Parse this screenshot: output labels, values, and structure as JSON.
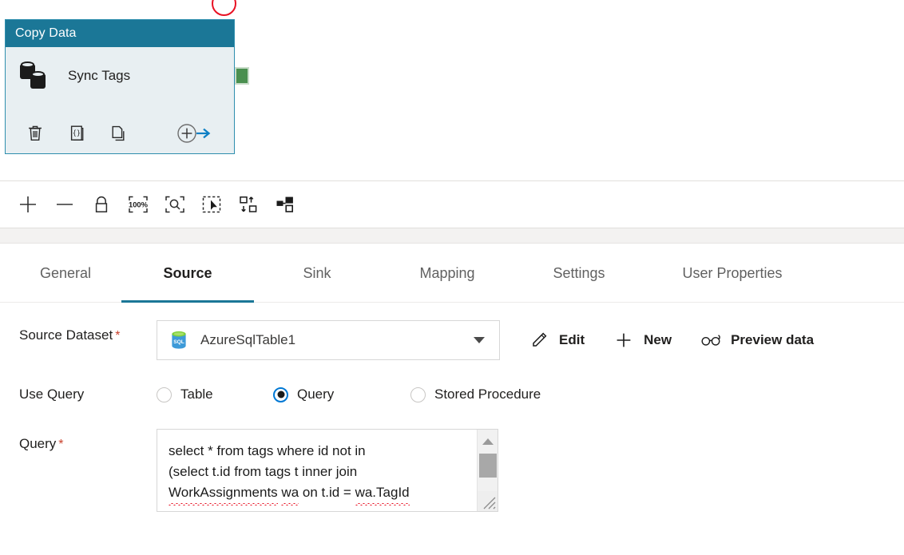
{
  "canvas": {
    "validation_marker": "error-circle",
    "activity": {
      "type_label": "Copy Data",
      "name": "Sync Tags",
      "icon": "copy-data-databases-icon",
      "actions": [
        {
          "name": "delete",
          "icon": "trash-icon"
        },
        {
          "name": "code",
          "icon": "code-braces-icon"
        },
        {
          "name": "clone",
          "icon": "copy-pages-icon"
        },
        {
          "name": "add-output",
          "icon": "add-output-arrow-icon"
        }
      ],
      "output_connector": "success-output",
      "header_color": "#1b7797",
      "body_color": "#e8eff2",
      "connector_color": "#4a8f4f",
      "validation_color": "#e81123"
    }
  },
  "canvas_toolbar": {
    "buttons": [
      {
        "name": "zoom-in",
        "icon": "plus-icon",
        "title": "Zoom in"
      },
      {
        "name": "zoom-out",
        "icon": "minus-icon",
        "title": "Zoom out"
      },
      {
        "name": "lock-canvas",
        "icon": "lock-icon",
        "title": "Lock canvas"
      },
      {
        "name": "zoom-to-100",
        "icon": "hundred-percent-icon",
        "title": "Zoom to 100%"
      },
      {
        "name": "zoom-to-fit",
        "icon": "zoom-fit-icon",
        "title": "Zoom to fit"
      },
      {
        "name": "select-all",
        "icon": "select-pointer-icon",
        "title": "Select all"
      },
      {
        "name": "auto-align",
        "icon": "auto-align-icon",
        "title": "Auto align"
      },
      {
        "name": "show-related",
        "icon": "related-nodes-icon",
        "title": "Show related"
      }
    ]
  },
  "panel": {
    "tabs": [
      {
        "label": "General",
        "active": false
      },
      {
        "label": "Source",
        "active": true
      },
      {
        "label": "Sink",
        "active": false
      },
      {
        "label": "Mapping",
        "active": false
      },
      {
        "label": "Settings",
        "active": false
      },
      {
        "label": "User Properties",
        "active": false
      }
    ],
    "active_tab_color": "#1b7797",
    "source": {
      "dataset": {
        "label": "Source Dataset",
        "required_marker": "*",
        "value": "AzureSqlTable1",
        "icon": "azure-sql-table-icon",
        "chevron": "chevron-down-icon",
        "actions": [
          {
            "name": "edit",
            "label": "Edit",
            "icon": "pencil-icon"
          },
          {
            "name": "new",
            "label": "New",
            "icon": "plus-icon"
          },
          {
            "name": "preview-data",
            "label": "Preview data",
            "icon": "glasses-icon"
          }
        ]
      },
      "use_query": {
        "label": "Use Query",
        "options": [
          {
            "label": "Table",
            "checked": false
          },
          {
            "label": "Query",
            "checked": true
          },
          {
            "label": "Stored Procedure",
            "checked": false
          }
        ],
        "selected": "Query",
        "checked_color": "#0078d4"
      },
      "query": {
        "label": "Query",
        "required_marker": "*",
        "line1": "select * from tags where id not in",
        "line2": "(select t.id from tags t inner join ",
        "line3_a": "WorkAssignments",
        "line3_b": "wa",
        "line3_mid": " on t.id = ",
        "line3_c": "wa.TagId",
        "spellcheck_color": "#e81123",
        "scrollbar": {
          "up": "scroll-up-arrow-icon",
          "down": "scroll-down-arrow-icon",
          "thumb": "scroll-thumb"
        },
        "resize_grip": "resize-grip-icon"
      }
    }
  }
}
